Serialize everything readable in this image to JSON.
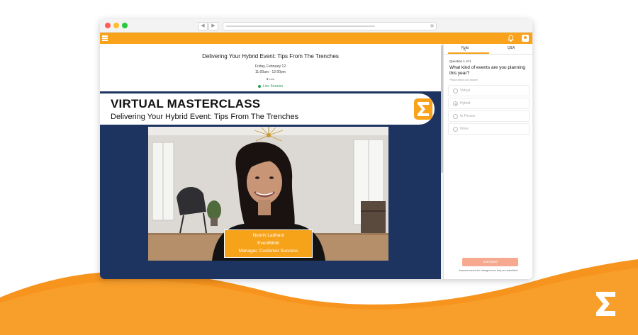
{
  "colors": {
    "accent": "#f9a21b",
    "video_background": "#1e3460",
    "live": "#2aa052",
    "submit": "#f6a98e"
  },
  "browser": {
    "back_icon": "chevron-left-icon",
    "forward_icon": "chevron-right-icon"
  },
  "appbar": {
    "menu_icon": "hamburger-icon",
    "notification_icon": "bell-icon",
    "profile_icon": "user-icon"
  },
  "session": {
    "title": "Delivering Your Hybrid Event: Tips From The Trenches",
    "date": "Friday, February 12",
    "time": "11:00am - 12:00pm",
    "location": "Live",
    "status": "Live Session"
  },
  "video": {
    "banner_title": "VIRTUAL MASTERCLASS",
    "banner_subtitle": "Delivering Your Hybrid Event: Tips From The Trenches",
    "speaker_name": "Noorin Ladhani",
    "speaker_company": "EventMobi",
    "speaker_role": "Manager, Customer Success"
  },
  "panel": {
    "tabs": [
      {
        "label": "Polls",
        "active": true
      },
      {
        "label": "Q&A",
        "active": false
      }
    ],
    "question_number": "Question 1 of 1",
    "question_text": "What kind of events are you planning this year?",
    "instruction": "Please select one answer",
    "options": [
      {
        "label": "Virtual",
        "selected": false
      },
      {
        "label": "Hybrid",
        "selected": true
      },
      {
        "label": "In Person",
        "selected": false
      },
      {
        "label": "None",
        "selected": false
      }
    ],
    "submit_label": "Submitted",
    "submit_note": "Answers cannot be changed once they are submitted."
  }
}
